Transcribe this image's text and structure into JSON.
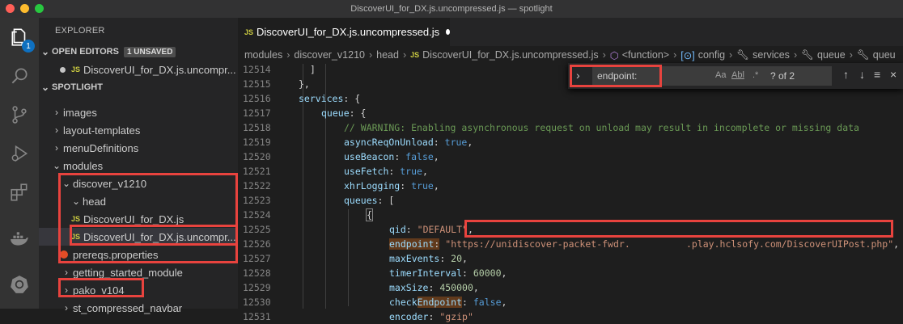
{
  "window": {
    "title": "DiscoverUI_for_DX.js.uncompressed.js — spotlight"
  },
  "activity": {
    "badge_count": "1"
  },
  "sidebar": {
    "title": "EXPLORER",
    "open_editors": {
      "label": "OPEN EDITORS",
      "unsaved": "1 UNSAVED",
      "file_tag": "JS",
      "file": "DiscoverUI_for_DX.js.uncompr..."
    },
    "spotlight": {
      "label": "SPOTLIGHT"
    },
    "tree": [
      {
        "label": "images"
      },
      {
        "label": "layout-templates"
      },
      {
        "label": "menuDefinitions"
      },
      {
        "label": "modules"
      },
      {
        "label": "discover_v1210"
      },
      {
        "label": "head"
      },
      {
        "label": "DiscoverUI_for_DX.js",
        "tag": "JS"
      },
      {
        "label": "DiscoverUI_for_DX.js.uncompr...",
        "tag": "JS"
      },
      {
        "label": "prereqs.properties"
      },
      {
        "label": "getting_started_module"
      },
      {
        "label": "pako_v104"
      },
      {
        "label": "st_compressed_navbar"
      }
    ]
  },
  "tab": {
    "tag": "JS",
    "label": "DiscoverUI_for_DX.js.uncompressed.js"
  },
  "breadcrumbs": {
    "modules": "modules",
    "discover": "discover_v1210",
    "head": "head",
    "tag": "JS",
    "file": "DiscoverUI_for_DX.js.uncompressed.js",
    "function": "<function>",
    "config": "config",
    "services": "services",
    "queue": "queue",
    "tail": "queu"
  },
  "find": {
    "query": "endpoint:",
    "opt_case": "Aa",
    "opt_word": "Abl",
    "opt_regex": ".*",
    "count": "? of 2"
  },
  "code": {
    "line_numbers": [
      "12514",
      "12515",
      "12516",
      "12517",
      "12518",
      "12519",
      "12520",
      "12521",
      "12522",
      "12523",
      "12524",
      "12525",
      "12526",
      "12527",
      "12528",
      "12529",
      "12530",
      "12531"
    ],
    "l12514": "]",
    "l12515": "},",
    "l12516_key": "services",
    "l12516_rest": ": {",
    "l12517_key": "queue",
    "l12517_rest": ": {",
    "l12518": "// WARNING: Enabling asynchronous request on unload may result in incomplete or missing data",
    "l12519_key": "asyncReqOnUnload",
    "l12519_val": "true",
    "l12520_key": "useBeacon",
    "l12520_val": "false",
    "l12521_key": "useFetch",
    "l12521_val": "true",
    "l12522_key": "xhrLogging",
    "l12522_val": "true",
    "l12523_key": "queues",
    "l12523_rest": ": [",
    "l12524": "{",
    "l12525_key": "qid",
    "l12525_val": "\"DEFAULT\"",
    "l12526_key": "endpoint",
    "l12526_val": "\"https://unidiscover-packet-fwdr.          .play.hclsofy.com/DiscoverUIPost.php\"",
    "l12527_key": "maxEvents",
    "l12527_val": "20",
    "l12528_key": "timerInterval",
    "l12528_val": "60000",
    "l12529_key": "maxSize",
    "l12529_val": "450000",
    "l12530_key_a": "check",
    "l12530_key_b": "Endpoint",
    "l12530_val": "false",
    "l12531_key": "encoder",
    "l12531_val": "\"gzip\""
  }
}
